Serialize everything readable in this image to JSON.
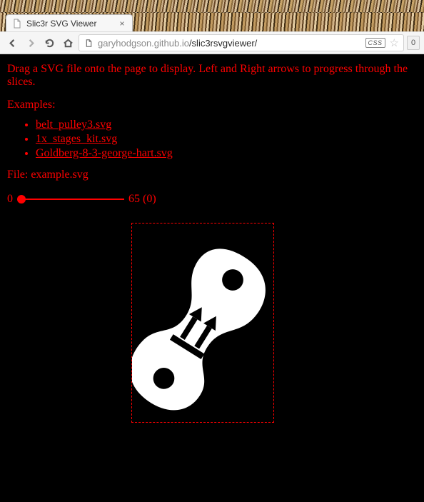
{
  "browser": {
    "tab_title": "Slic3r SVG Viewer",
    "url_host": "garyhodgson.github.io",
    "url_path": "/slic3rsvgviewer/",
    "css_badge": "CSS",
    "ext_counter": "0"
  },
  "page": {
    "instructions": "Drag a SVG file onto the page to display. Left and Right arrows to progress through the slices.",
    "examples_label": "Examples:",
    "examples": [
      "belt_pulley3.svg",
      "1x_stages_kit.svg",
      "Goldberg-8-3-george-hart.svg"
    ],
    "file_prefix": "File: ",
    "file_name": "example.svg",
    "slider": {
      "min": "0",
      "max": "65",
      "value": "0",
      "readout": "65 (0)"
    }
  }
}
